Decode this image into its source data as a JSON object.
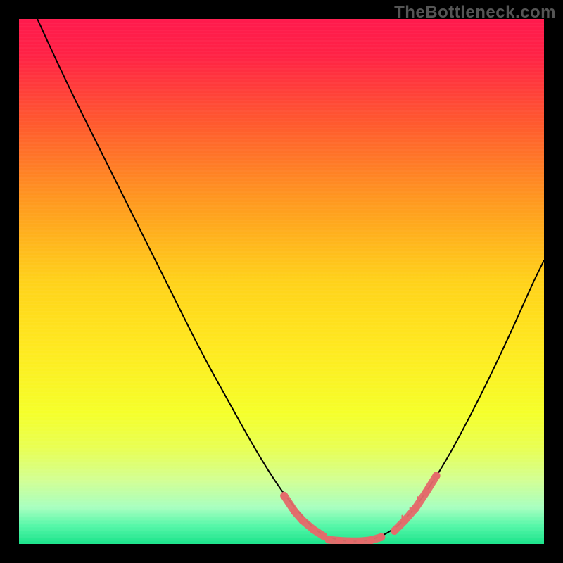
{
  "watermark": "TheBottleneck.com",
  "chart_data": {
    "type": "line",
    "title": "",
    "xlabel": "",
    "ylabel": "",
    "xlim": [
      0,
      100
    ],
    "ylim": [
      0,
      100
    ],
    "grid": false,
    "legend": false,
    "background": {
      "type": "vertical-gradient",
      "stops": [
        {
          "pos": 0.0,
          "color": "#ff1a4d"
        },
        {
          "pos": 0.07,
          "color": "#ff2245"
        },
        {
          "pos": 0.2,
          "color": "#ff5a2e"
        },
        {
          "pos": 0.35,
          "color": "#ff9a1f"
        },
        {
          "pos": 0.5,
          "color": "#ffd21a"
        },
        {
          "pos": 0.62,
          "color": "#ffe81f"
        },
        {
          "pos": 0.75,
          "color": "#f5ff2a"
        },
        {
          "pos": 0.82,
          "color": "#e8ff55"
        },
        {
          "pos": 0.88,
          "color": "#d2ff95"
        },
        {
          "pos": 0.93,
          "color": "#a8ffc0"
        },
        {
          "pos": 0.965,
          "color": "#55f7a8"
        },
        {
          "pos": 1.0,
          "color": "#19e38a"
        }
      ]
    },
    "series": [
      {
        "name": "bottleneck-curve",
        "color": "#000000",
        "width": 2,
        "points": [
          {
            "x": 3.5,
            "y": 100.0
          },
          {
            "x": 6.0,
            "y": 94.5
          },
          {
            "x": 10.0,
            "y": 86.0
          },
          {
            "x": 15.0,
            "y": 76.0
          },
          {
            "x": 20.0,
            "y": 66.0
          },
          {
            "x": 25.0,
            "y": 56.0
          },
          {
            "x": 30.0,
            "y": 46.0
          },
          {
            "x": 35.0,
            "y": 36.0
          },
          {
            "x": 40.0,
            "y": 27.0
          },
          {
            "x": 45.0,
            "y": 18.0
          },
          {
            "x": 50.0,
            "y": 10.0
          },
          {
            "x": 55.0,
            "y": 4.0
          },
          {
            "x": 58.0,
            "y": 1.5
          },
          {
            "x": 62.0,
            "y": 0.5
          },
          {
            "x": 66.0,
            "y": 0.5
          },
          {
            "x": 70.0,
            "y": 1.8
          },
          {
            "x": 74.0,
            "y": 5.0
          },
          {
            "x": 78.0,
            "y": 10.5
          },
          {
            "x": 82.0,
            "y": 17.0
          },
          {
            "x": 86.0,
            "y": 24.5
          },
          {
            "x": 90.0,
            "y": 32.5
          },
          {
            "x": 94.0,
            "y": 41.0
          },
          {
            "x": 98.0,
            "y": 50.0
          },
          {
            "x": 100.0,
            "y": 54.0
          }
        ]
      },
      {
        "name": "left-marked-segment",
        "color": "#e46b6b",
        "marker": "capsule",
        "points": [
          {
            "x": 50.5,
            "y": 9.2
          },
          {
            "x": 52.5,
            "y": 6.2
          },
          {
            "x": 54.0,
            "y": 4.5
          },
          {
            "x": 56.0,
            "y": 2.8
          },
          {
            "x": 58.0,
            "y": 1.5
          }
        ]
      },
      {
        "name": "bottom-marked-segment",
        "color": "#e46b6b",
        "marker": "capsule",
        "points": [
          {
            "x": 59.0,
            "y": 0.8
          },
          {
            "x": 61.0,
            "y": 0.6
          },
          {
            "x": 63.0,
            "y": 0.5
          },
          {
            "x": 65.0,
            "y": 0.5
          },
          {
            "x": 67.0,
            "y": 0.7
          },
          {
            "x": 69.0,
            "y": 1.3
          }
        ]
      },
      {
        "name": "right-marked-segment",
        "color": "#e46b6b",
        "marker": "capsule",
        "points": [
          {
            "x": 71.5,
            "y": 2.5
          },
          {
            "x": 73.5,
            "y": 4.5
          },
          {
            "x": 75.5,
            "y": 6.8
          },
          {
            "x": 77.5,
            "y": 9.8
          },
          {
            "x": 79.5,
            "y": 13.0
          }
        ]
      }
    ]
  }
}
